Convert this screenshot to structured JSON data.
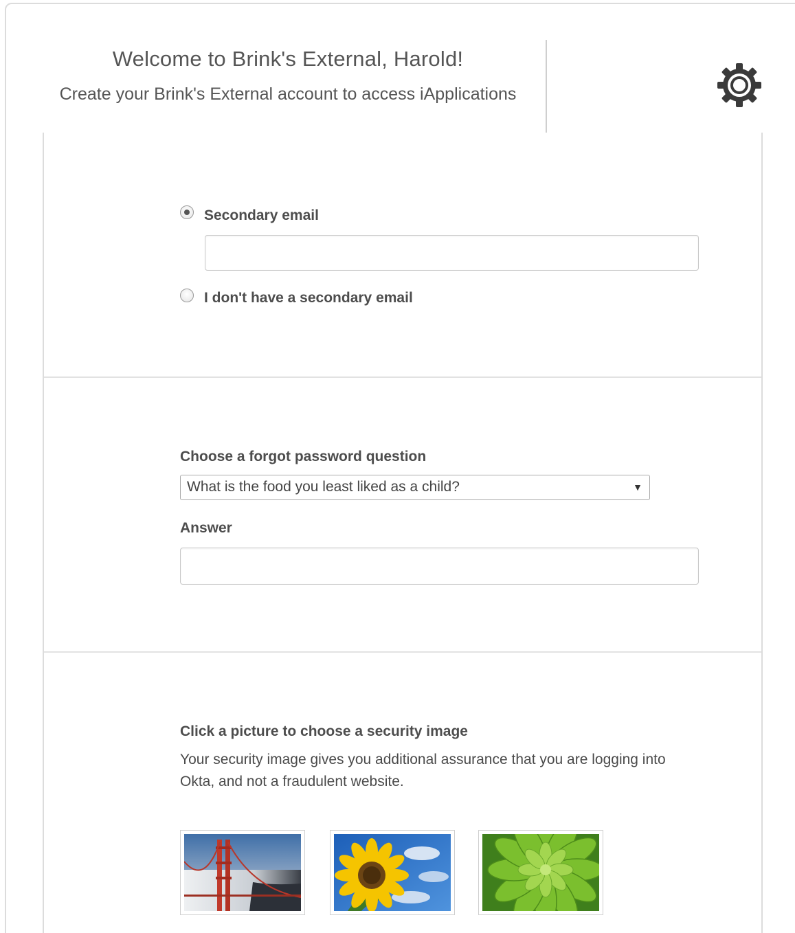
{
  "header": {
    "title": "Welcome to Brink's External, Harold!",
    "subtitle": "Create your Brink's External account to access iApplications",
    "settings_icon": "gear-icon"
  },
  "secondary_email": {
    "option_label": "Secondary email",
    "option_selected": true,
    "input_value": "",
    "input_placeholder": "",
    "no_email_label": "I don't have a secondary email",
    "no_email_selected": false
  },
  "forgot_password": {
    "question_label": "Choose a forgot password question",
    "selected_question": "What is the food you least liked as a child?",
    "answer_label": "Answer",
    "answer_value": ""
  },
  "security_image": {
    "title": "Click a picture to choose a security image",
    "description": "Your security image gives you additional assurance that you are logging into Okta, and not a fraudulent website.",
    "images": [
      {
        "name": "golden-gate-bridge-image"
      },
      {
        "name": "sunflower-image"
      },
      {
        "name": "succulent-plant-image"
      }
    ]
  },
  "colors": {
    "text": "#4a4a4a",
    "border": "#dcdcdc",
    "background": "#ffffff"
  }
}
